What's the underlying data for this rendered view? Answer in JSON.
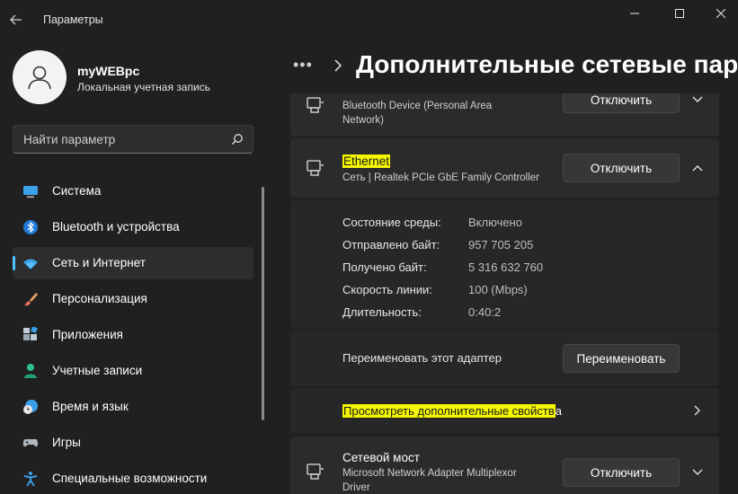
{
  "window": {
    "title": "Параметры",
    "controls": [
      "minimize",
      "maximize",
      "close"
    ]
  },
  "user": {
    "name": "myWEBpc",
    "account_type": "Локальная учетная запись"
  },
  "search": {
    "placeholder": "Найти параметр"
  },
  "sidebar": {
    "items": [
      {
        "label": "Система",
        "icon": "monitor-icon"
      },
      {
        "label": "Bluetooth и устройства",
        "icon": "bluetooth-icon"
      },
      {
        "label": "Сеть и Интернет",
        "icon": "wifi-icon",
        "active": true
      },
      {
        "label": "Персонализация",
        "icon": "brush-icon"
      },
      {
        "label": "Приложения",
        "icon": "apps-icon"
      },
      {
        "label": "Учетные записи",
        "icon": "person-icon"
      },
      {
        "label": "Время и язык",
        "icon": "clock-globe-icon"
      },
      {
        "label": "Игры",
        "icon": "gamepad-icon"
      },
      {
        "label": "Специальные возможности",
        "icon": "accessibility-icon"
      }
    ]
  },
  "header": {
    "breadcrumb_more": "•••",
    "title": "Дополнительные сетевые парам"
  },
  "adapters": {
    "bluetooth": {
      "desc_line1": "Bluetooth Device (Personal Area",
      "desc_line2": "Network)",
      "button": "Отключить"
    },
    "ethernet": {
      "name": "Ethernet",
      "desc": "Сеть | Realtek PCIe GbE Family Controller",
      "button": "Отключить",
      "properties": [
        {
          "label": "Состояние среды:",
          "value": "Включено"
        },
        {
          "label": "Отправлено байт:",
          "value": "957 705 205"
        },
        {
          "label": "Получено байт:",
          "value": "5 316 632 760"
        },
        {
          "label": "Скорость линии:",
          "value": "100 (Mbps)"
        },
        {
          "label": "Длительность:",
          "value": "0:40:2"
        }
      ],
      "rename_label": "Переименовать этот адаптер",
      "rename_button": "Переименовать",
      "more_props_highlight": "Просмотреть дополнительные свойств",
      "more_props_rest": "а"
    },
    "bridge": {
      "name": "Сетевой мост",
      "desc_line1": "Microsoft Network Adapter Multiplexor",
      "desc_line2": "Driver",
      "button": "Отключить"
    }
  },
  "colors": {
    "background": "#202020",
    "card": "#2b2b2b",
    "accent": "#4cc2ff",
    "highlight": "#f4f700"
  }
}
